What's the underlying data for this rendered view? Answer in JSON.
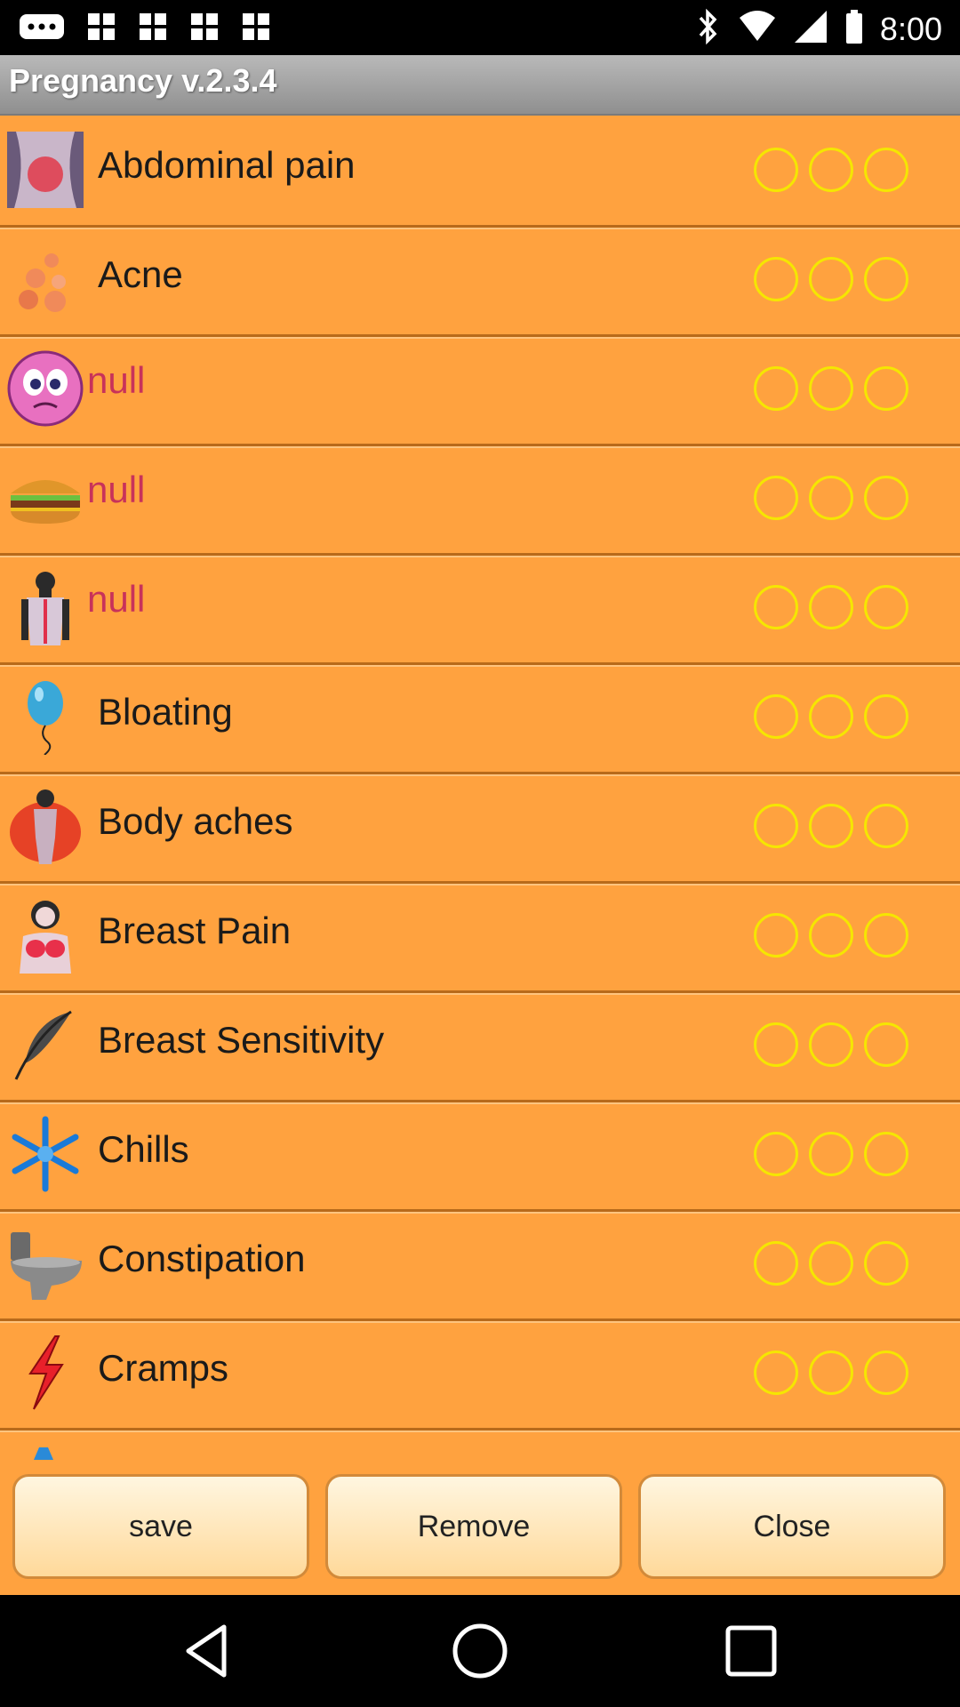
{
  "status_bar": {
    "time": "8:00"
  },
  "title": "Pregnancy v.2.3.4",
  "symptoms": [
    {
      "label": "Abdominal pain",
      "icon": "abdomen-icon",
      "null": false
    },
    {
      "label": "Acne",
      "icon": "acne-dots-icon",
      "null": false
    },
    {
      "label": "null",
      "icon": "face-emoji-icon",
      "null": true
    },
    {
      "label": "null",
      "icon": "burger-icon",
      "null": true
    },
    {
      "label": "null",
      "icon": "back-pain-icon",
      "null": true
    },
    {
      "label": "Bloating",
      "icon": "balloon-icon",
      "null": false
    },
    {
      "label": "Body aches",
      "icon": "body-icon",
      "null": false
    },
    {
      "label": "Breast Pain",
      "icon": "breast-icon",
      "null": false
    },
    {
      "label": "Breast Sensitivity",
      "icon": "feather-icon",
      "null": false
    },
    {
      "label": "Chills",
      "icon": "snowflake-icon",
      "null": false
    },
    {
      "label": "Constipation",
      "icon": "toilet-icon",
      "null": false
    },
    {
      "label": "Cramps",
      "icon": "lightning-icon",
      "null": false
    }
  ],
  "buttons": {
    "save": "save",
    "remove": "Remove",
    "close": "Close"
  },
  "colors": {
    "list_bg": "#ffa23f",
    "rating_ring": "#f5e600",
    "null_text": "#c8325a"
  }
}
